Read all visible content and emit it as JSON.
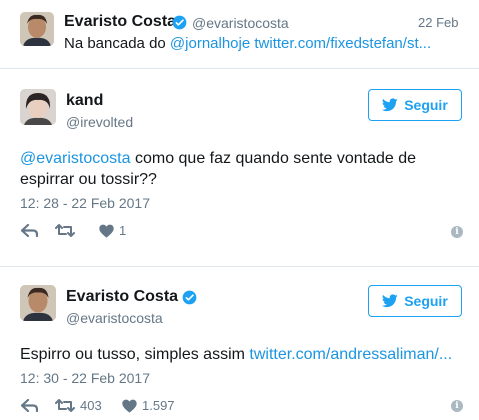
{
  "quoted_tweet": {
    "name": "Evaristo Costa",
    "handle": "@evaristocosta",
    "date": "22 Feb",
    "text_prefix": "Na bancada do ",
    "mention": "@jornalhoje",
    "link": "twitter.com/fixedstefan/st..."
  },
  "tweet1": {
    "name": "kand",
    "handle": "@irevolted",
    "follow_label": "Seguir",
    "mention": "@evaristocosta",
    "text_line1_rest": " como que faz quando sente vontade de",
    "text_line2": "espirrar ou tossir??",
    "timestamp": "12: 28 - 22 Feb 2017",
    "likes": "1"
  },
  "tweet2": {
    "name": "Evaristo Costa",
    "handle": "@evaristocosta",
    "follow_label": "Seguir",
    "text_prefix": "Espirro ou tusso, simples assim ",
    "link": "twitter.com/andressaliman/...",
    "timestamp": "12: 30 - 22 Feb 2017",
    "retweets": "403",
    "likes": "1.597"
  },
  "colors": {
    "accent": "#1da1f2",
    "link": "#1b95e0",
    "muted": "#657786",
    "divider": "#e1e8ed"
  },
  "icons": [
    "verified-badge-icon",
    "twitter-bird-icon",
    "reply-icon",
    "retweet-icon",
    "heart-icon",
    "info-icon"
  ]
}
